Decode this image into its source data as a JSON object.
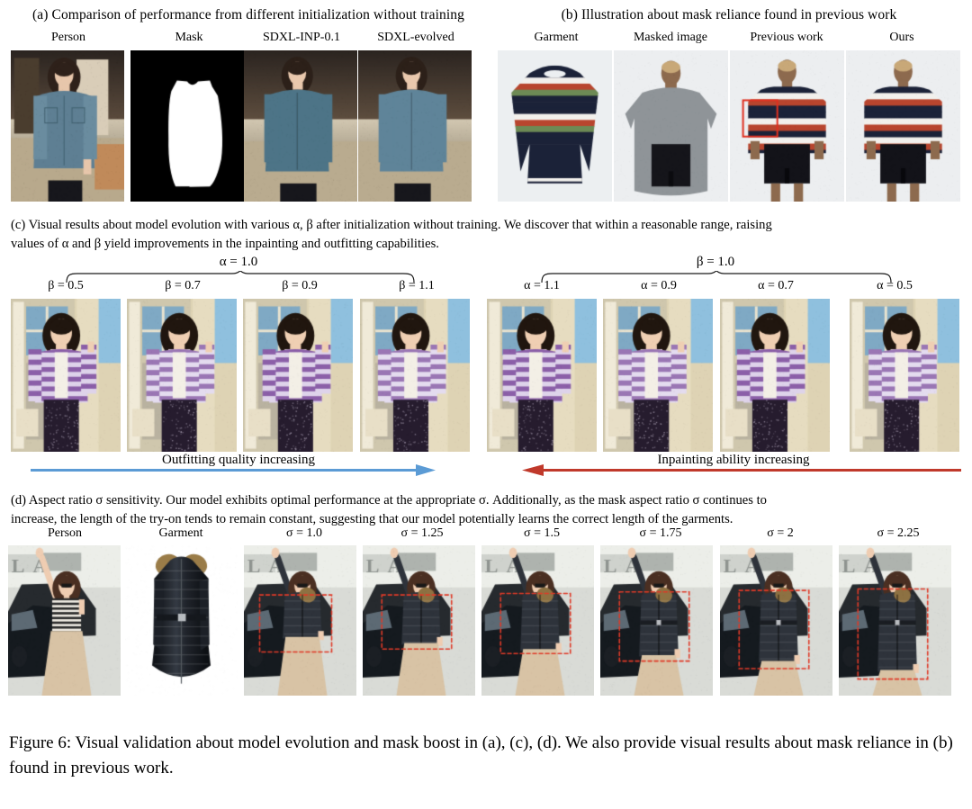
{
  "figure": {
    "caption": "Figure 6: Visual validation about model evolution and mask boost in (a), (c), (d). We also provide visual results about mask reliance in (b) found in previous work."
  },
  "panel_a": {
    "title": "(a) Comparison of performance from different initialization without training",
    "columns": [
      {
        "label": "Person",
        "kind": "photo-person-blue-shirt"
      },
      {
        "label": "Mask",
        "kind": "binary-mask"
      },
      {
        "label": "SDXL-INP-0.1",
        "kind": "photo-tryon"
      },
      {
        "label": "SDXL-evolved",
        "kind": "photo-tryon"
      }
    ]
  },
  "panel_b": {
    "title": "(b) Illustration about mask reliance found in previous work",
    "columns": [
      {
        "label": "Garment",
        "kind": "garment-striped-sweater"
      },
      {
        "label": "Masked image",
        "kind": "masked-model"
      },
      {
        "label": "Previous work",
        "kind": "tryon-with-highlight",
        "highlight_color": "#e03020"
      },
      {
        "label": "Ours",
        "kind": "tryon"
      }
    ]
  },
  "panel_c": {
    "title_line1": "(c) Visual results about model evolution with various  α, β  after initialization without training. We discover that within a reasonable range, raising",
    "title_line2": "values of α and β yield improvements in the inpainting and outfitting capabilities.",
    "left_group": {
      "brace_label": "α = 1.0",
      "columns": [
        "β = 0.5",
        "β = 0.7",
        "β = 0.9",
        "β = 1.1"
      ]
    },
    "right_group": {
      "brace_label": "β = 1.0",
      "columns": [
        "α = 1.1",
        "α = 0.9",
        "α = 0.7",
        "α = 0.5"
      ]
    },
    "arrows": [
      {
        "label": "Outfitting quality increasing",
        "direction": "right",
        "color": "#5b9bd5"
      },
      {
        "label": "Inpainting ability increasing",
        "direction": "left",
        "color": "#c0392b"
      }
    ]
  },
  "panel_d": {
    "title_line1": "(d) Aspect ratio σ sensitivity. Our model exhibits optimal performance at the appropriate σ. Additionally, as the mask aspect ratio σ continues to",
    "title_line2": "increase, the length of the try-on tends to remain constant, suggesting that our model potentially learns the correct length of the garments.",
    "columns": [
      {
        "label": "Person",
        "kind": "photo-person-waving"
      },
      {
        "label": "Garment",
        "kind": "garment-black-puffer"
      },
      {
        "label": "σ = 1.0",
        "kind": "tryon-box"
      },
      {
        "label": "σ = 1.25",
        "kind": "tryon-box"
      },
      {
        "label": "σ = 1.5",
        "kind": "tryon-box"
      },
      {
        "label": "σ = 1.75",
        "kind": "tryon-box"
      },
      {
        "label": "σ = 2",
        "kind": "tryon-box"
      },
      {
        "label": "σ = 2.25",
        "kind": "tryon-box"
      }
    ],
    "box_color": "#e03a28"
  }
}
